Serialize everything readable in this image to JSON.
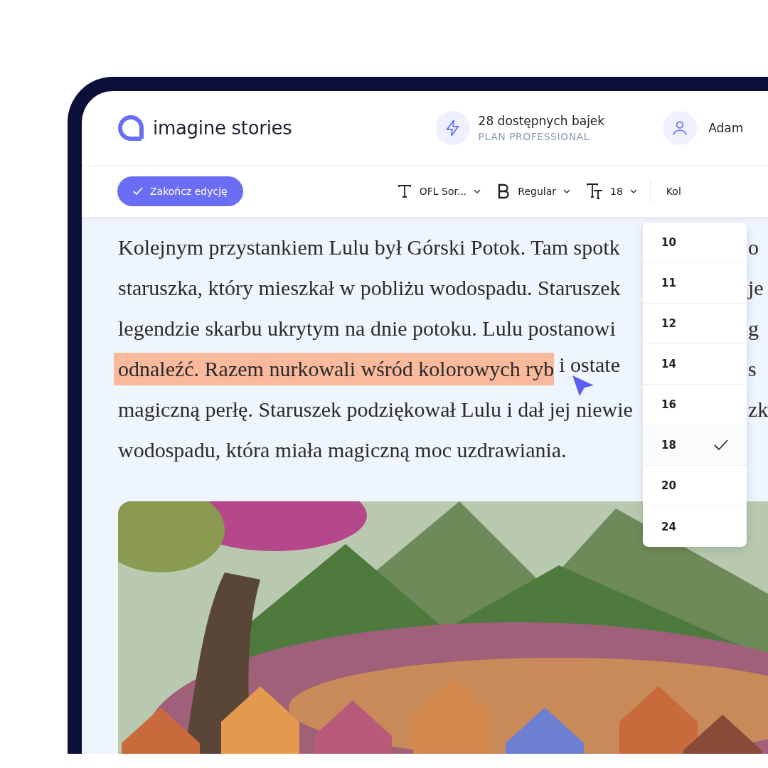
{
  "header": {
    "logo": "imagine stories",
    "credits": {
      "title": "28 dostępnych bajek",
      "plan": "PLAN PROFESSIONAL"
    },
    "user": {
      "name": "Adam"
    }
  },
  "toolbar": {
    "finish_button": "Zakończ edycję",
    "font": "OFL Sor...",
    "weight": "Regular",
    "size": "18",
    "color_label": "Kol"
  },
  "story": {
    "lines": [
      {
        "segments": [
          {
            "text": "Kolejnym przystankiem Lulu był Górski Potok. Tam spotk",
            "highlighted": false
          }
        ],
        "right": "o"
      },
      {
        "segments": [
          {
            "text": "staruszka, który mieszkał w pobliżu wodospadu. Staruszek",
            "highlighted": false
          }
        ],
        "right": "je"
      },
      {
        "segments": [
          {
            "text": "legendzie skarbu ukrytym na dnie potoku. Lulu postanowi",
            "highlighted": false
          }
        ],
        "right": "g"
      },
      {
        "segments": [
          {
            "text": "odnaleźć. Razem nurkowali wśród kolorowych ryb",
            "highlighted": true
          },
          {
            "text": "i ostate",
            "highlighted": false
          }
        ],
        "right": "s"
      },
      {
        "segments": [
          {
            "text": "magiczną perłę. Staruszek podziękował Lulu i dał jej niewie",
            "highlighted": false
          }
        ],
        "right": "zk"
      },
      {
        "segments": [
          {
            "text": "wodospadu, która miała magiczną moc uzdrawiania.",
            "highlighted": false
          }
        ]
      }
    ]
  },
  "size_menu": {
    "items": [
      {
        "label": "10",
        "selected": false
      },
      {
        "label": "11",
        "selected": false
      },
      {
        "label": "12",
        "selected": false
      },
      {
        "label": "14",
        "selected": false
      },
      {
        "label": "16",
        "selected": false
      },
      {
        "label": "18",
        "selected": true
      },
      {
        "label": "20",
        "selected": false
      },
      {
        "label": "24",
        "selected": false
      }
    ]
  }
}
